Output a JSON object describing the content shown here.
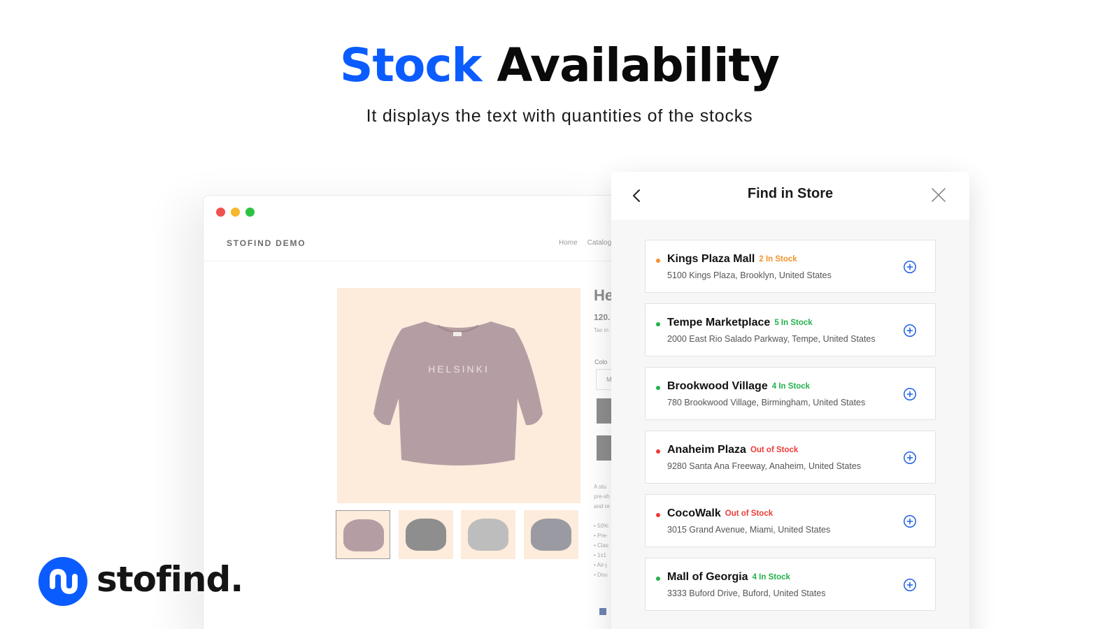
{
  "hero": {
    "title_accent": "Stock",
    "title_rest": "Availability",
    "subtitle": "It displays the text with quantities of the stocks",
    "accent_color": "#0b5cff"
  },
  "browser": {
    "window_dots": [
      "#f0524f",
      "#f5b72c",
      "#2bc240"
    ],
    "site_logo": "STOFIND DEMO",
    "nav": [
      "Home",
      "Catalog"
    ],
    "product": {
      "image_text": "HELSINKI",
      "title": "He",
      "price": "120.",
      "tax": "Tax in",
      "color_label": "Colo",
      "select_value": "M",
      "description": "A stu\npre-sh\nand re\n\n• 50%\n• Pre-\n• Clas\n• 1x1\n• Air-j\n• Dou",
      "thumbnail_colors": [
        "#b59ea3",
        "#8e8e8e",
        "#bdbdbd",
        "#9a9ba2"
      ]
    }
  },
  "panel": {
    "title": "Find in Store",
    "back_icon": "chevron-left-icon",
    "close_icon": "close-icon",
    "stores": [
      {
        "name": "Kings Plaza Mall",
        "status": "2 In Stock",
        "status_color": "#f5922b",
        "address": "5100 Kings Plaza, Brooklyn, United States"
      },
      {
        "name": "Tempe Marketplace",
        "status": "5 In Stock",
        "status_color": "#22b14c",
        "address": "2000 East Rio Salado Parkway, Tempe, United States"
      },
      {
        "name": "Brookwood Village",
        "status": "4 In Stock",
        "status_color": "#22b14c",
        "address": "780 Brookwood Village, Birmingham, United States"
      },
      {
        "name": "Anaheim Plaza",
        "status": "Out of Stock",
        "status_color": "#ec3b36",
        "address": "9280 Santa Ana Freeway, Anaheim, United States"
      },
      {
        "name": "CocoWalk",
        "status": "Out of Stock",
        "status_color": "#ec3b36",
        "address": "3015 Grand Avenue, Miami, United States"
      },
      {
        "name": "Mall of Georgia",
        "status": "4 In Stock",
        "status_color": "#22b14c",
        "address": "3333 Buford Drive, Buford, United States"
      }
    ]
  },
  "brand": {
    "name": "stofind.",
    "color": "#0b5cff"
  }
}
